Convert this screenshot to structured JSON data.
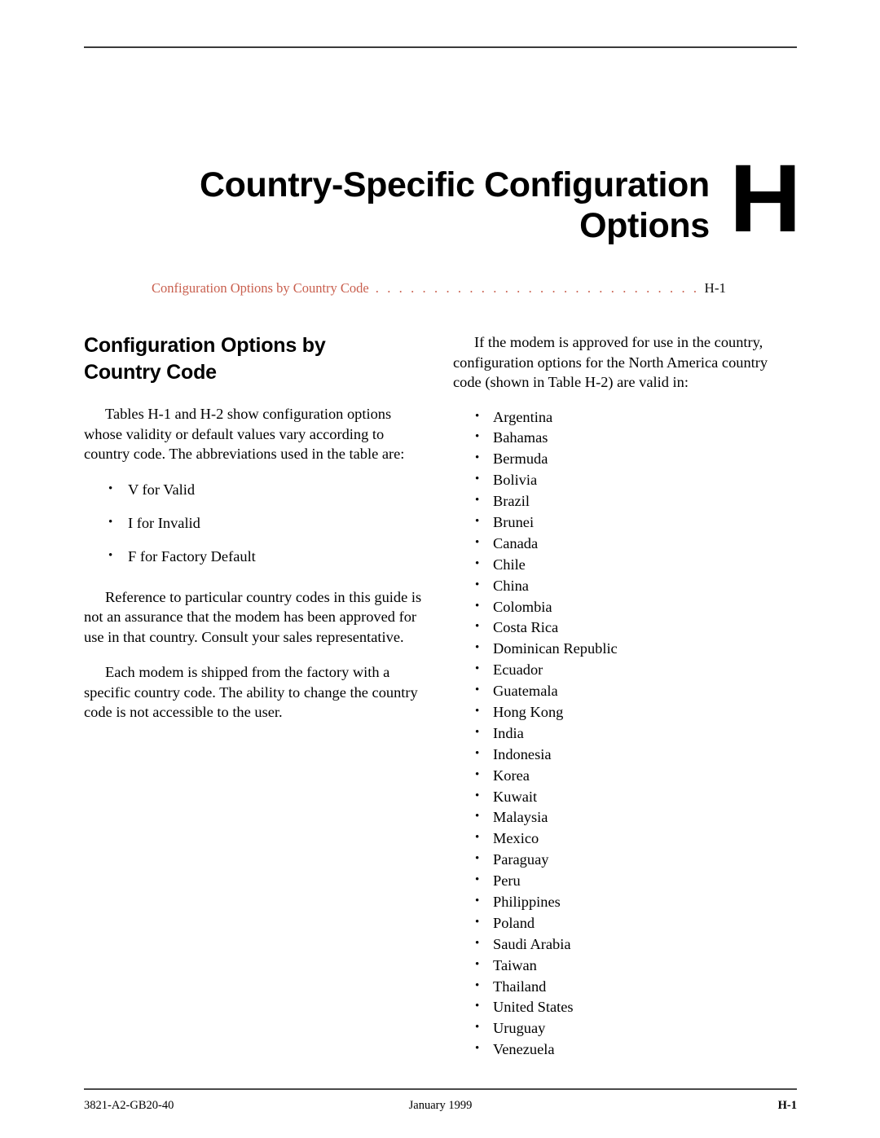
{
  "document": {
    "chapter_title_line1": "Country-Specific Configuration",
    "chapter_title_line2": "Options",
    "chapter_letter": "H"
  },
  "toc": {
    "entry_label": "Configuration Options by Country Code",
    "leader": ". . . . . . . . . . . . . . . . . . . . . . . . . . . . . . . . . . . . . . . . . . . . . .",
    "page": "H-1",
    "color": "#c9604f"
  },
  "left_column": {
    "heading": "Configuration Options by\nCountry Code",
    "paragraph1": "Tables H-1 and H-2 show configuration options whose validity or default values vary according to country code. The abbreviations used in the table are:",
    "abbreviations": [
      "V for Valid",
      "I for Invalid",
      "F for Factory Default"
    ],
    "paragraph2": "Reference to particular country codes in this guide is not an assurance that the modem has been approved for use in that country. Consult your sales representative.",
    "paragraph3": "Each modem is shipped from the factory with a specific country code. The ability to change the country code is not accessible to the user."
  },
  "right_column": {
    "paragraph1": "If the modem is approved for use in the country, configuration options for the North America country code (shown in Table H-2) are valid in:",
    "countries": [
      "Argentina",
      "Bahamas",
      "Bermuda",
      "Bolivia",
      "Brazil",
      "Brunei",
      "Canada",
      "Chile",
      "China",
      "Colombia",
      "Costa Rica",
      "Dominican Republic",
      "Ecuador",
      "Guatemala",
      "Hong Kong",
      "India",
      "Indonesia",
      "Korea",
      "Kuwait",
      "Malaysia",
      "Mexico",
      "Paraguay",
      "Peru",
      "Philippines",
      "Poland",
      "Saudi Arabia",
      "Taiwan",
      "Thailand",
      "United States",
      "Uruguay",
      "Venezuela"
    ]
  },
  "footer": {
    "document_number": "3821-A2-GB20-40",
    "date": "January 1999",
    "page_number": "H-1"
  }
}
